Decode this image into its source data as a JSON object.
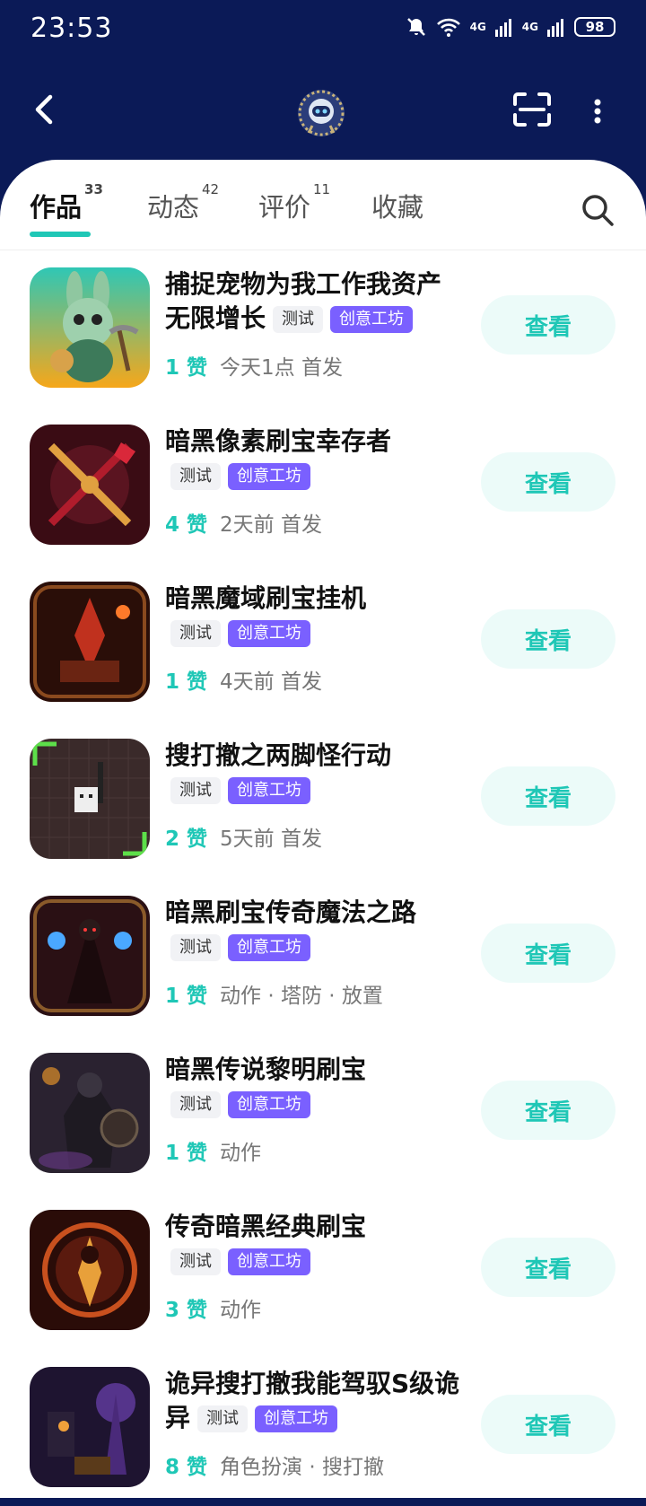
{
  "status_bar": {
    "time": "23:53",
    "network_1": "4G",
    "network_2": "4G",
    "battery": "98"
  },
  "tabs": [
    {
      "label": "作品",
      "count": "33"
    },
    {
      "label": "动态",
      "count": "42"
    },
    {
      "label": "评价",
      "count": "11"
    },
    {
      "label": "收藏",
      "count": ""
    }
  ],
  "items": [
    {
      "title": "捕捉宠物为我工作我资产无限增长",
      "tag_test": "测试",
      "tag_workshop": "创意工坊",
      "likes": "1 赞",
      "info": "今天1点 首发",
      "button": "查看"
    },
    {
      "title": "暗黑像素刷宝幸存者",
      "tag_test": "测试",
      "tag_workshop": "创意工坊",
      "likes": "4 赞",
      "info": "2天前 首发",
      "button": "查看"
    },
    {
      "title": "暗黑魔域刷宝挂机",
      "tag_test": "测试",
      "tag_workshop": "创意工坊",
      "likes": "1 赞",
      "info": "4天前 首发",
      "button": "查看"
    },
    {
      "title": "搜打撤之两脚怪行动",
      "tag_test": "测试",
      "tag_workshop": "创意工坊",
      "likes": "2 赞",
      "info": "5天前 首发",
      "button": "查看"
    },
    {
      "title": "暗黑刷宝传奇魔法之路",
      "tag_test": "测试",
      "tag_workshop": "创意工坊",
      "likes": "1 赞",
      "info": "动作 · 塔防 · 放置",
      "button": "查看"
    },
    {
      "title": "暗黑传说黎明刷宝",
      "tag_test": "测试",
      "tag_workshop": "创意工坊",
      "likes": "1 赞",
      "info": "动作",
      "button": "查看"
    },
    {
      "title": "传奇暗黑经典刷宝",
      "tag_test": "测试",
      "tag_workshop": "创意工坊",
      "likes": "3 赞",
      "info": "动作",
      "button": "查看"
    },
    {
      "title": "诡异搜打撤我能驾驭S级诡异",
      "tag_test": "测试",
      "tag_workshop": "创意工坊",
      "likes": "8 赞",
      "info": "角色扮演 · 搜打撤",
      "button": "查看"
    }
  ],
  "colors": {
    "header_bg": "#0b1a57",
    "accent": "#1fc7b6",
    "workshop_tag": "#7a60ff"
  }
}
